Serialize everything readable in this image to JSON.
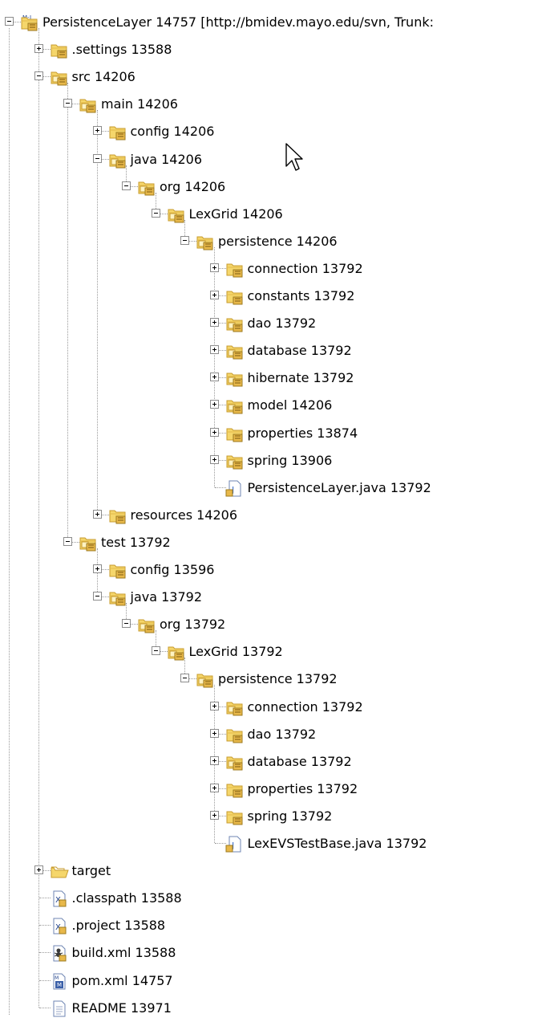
{
  "tree": {
    "nodes": [
      {
        "label": "PersistenceLayer 14757 [http://bmidev.mayo.edu/svn, Trunk:",
        "depth": 0,
        "icon": "maven-project-icon",
        "toggle": "minus",
        "name": "tree-node-persistencelayer-project"
      },
      {
        "label": ".settings 13588",
        "depth": 1,
        "icon": "folder-icon",
        "toggle": "plus",
        "name": "tree-node-settings"
      },
      {
        "label": "src 14206",
        "depth": 1,
        "icon": "source-folder-icon",
        "toggle": "minus",
        "name": "tree-node-src"
      },
      {
        "label": "main 14206",
        "depth": 2,
        "icon": "source-folder-icon",
        "toggle": "minus",
        "name": "tree-node-main"
      },
      {
        "label": "config 14206",
        "depth": 3,
        "icon": "folder-icon",
        "toggle": "plus",
        "name": "tree-node-main-config"
      },
      {
        "label": "java 14206",
        "depth": 3,
        "icon": "source-folder-icon",
        "toggle": "minus",
        "name": "tree-node-main-java"
      },
      {
        "label": "org 14206",
        "depth": 4,
        "icon": "source-folder-icon",
        "toggle": "minus",
        "name": "tree-node-main-org"
      },
      {
        "label": "LexGrid 14206",
        "depth": 5,
        "icon": "source-folder-icon",
        "toggle": "minus",
        "name": "tree-node-main-lexgrid"
      },
      {
        "label": "persistence 14206",
        "depth": 6,
        "icon": "source-folder-icon",
        "toggle": "minus",
        "name": "tree-node-main-persistence"
      },
      {
        "label": "connection 13792",
        "depth": 7,
        "icon": "folder-icon",
        "toggle": "plus",
        "name": "tree-node-main-connection"
      },
      {
        "label": "constants 13792",
        "depth": 7,
        "icon": "folder-icon",
        "toggle": "plus",
        "name": "tree-node-main-constants"
      },
      {
        "label": "dao 13792",
        "depth": 7,
        "icon": "source-folder-icon",
        "toggle": "plus",
        "name": "tree-node-main-dao"
      },
      {
        "label": "database 13792",
        "depth": 7,
        "icon": "source-folder-icon",
        "toggle": "plus",
        "name": "tree-node-main-database"
      },
      {
        "label": "hibernate 13792",
        "depth": 7,
        "icon": "source-folder-icon",
        "toggle": "plus",
        "name": "tree-node-main-hibernate"
      },
      {
        "label": "model 14206",
        "depth": 7,
        "icon": "source-folder-icon",
        "toggle": "plus",
        "name": "tree-node-main-model"
      },
      {
        "label": "properties 13874",
        "depth": 7,
        "icon": "folder-icon",
        "toggle": "plus",
        "name": "tree-node-main-properties"
      },
      {
        "label": "spring 13906",
        "depth": 7,
        "icon": "source-folder-icon",
        "toggle": "plus",
        "name": "tree-node-main-spring"
      },
      {
        "label": "PersistenceLayer.java 13792",
        "depth": 7,
        "icon": "java-file-icon",
        "toggle": "none",
        "name": "tree-node-persistencelayer-java"
      },
      {
        "label": "resources 14206",
        "depth": 3,
        "icon": "folder-icon",
        "toggle": "plus",
        "name": "tree-node-resources"
      },
      {
        "label": "test 13792",
        "depth": 2,
        "icon": "source-folder-icon",
        "toggle": "minus",
        "name": "tree-node-test"
      },
      {
        "label": "config 13596",
        "depth": 3,
        "icon": "folder-icon",
        "toggle": "plus",
        "name": "tree-node-test-config"
      },
      {
        "label": "java 13792",
        "depth": 3,
        "icon": "source-folder-icon",
        "toggle": "minus",
        "name": "tree-node-test-java"
      },
      {
        "label": "org 13792",
        "depth": 4,
        "icon": "source-folder-icon",
        "toggle": "minus",
        "name": "tree-node-test-org"
      },
      {
        "label": "LexGrid 13792",
        "depth": 5,
        "icon": "source-folder-icon",
        "toggle": "minus",
        "name": "tree-node-test-lexgrid"
      },
      {
        "label": "persistence 13792",
        "depth": 6,
        "icon": "source-folder-icon",
        "toggle": "minus",
        "name": "tree-node-test-persistence"
      },
      {
        "label": "connection 13792",
        "depth": 7,
        "icon": "source-folder-icon",
        "toggle": "plus",
        "name": "tree-node-test-connection"
      },
      {
        "label": "dao 13792",
        "depth": 7,
        "icon": "folder-icon",
        "toggle": "plus",
        "name": "tree-node-test-dao"
      },
      {
        "label": "database 13792",
        "depth": 7,
        "icon": "source-folder-icon",
        "toggle": "plus",
        "name": "tree-node-test-database"
      },
      {
        "label": "properties 13792",
        "depth": 7,
        "icon": "folder-icon",
        "toggle": "plus",
        "name": "tree-node-test-properties"
      },
      {
        "label": "spring 13792",
        "depth": 7,
        "icon": "folder-icon",
        "toggle": "plus",
        "name": "tree-node-test-spring"
      },
      {
        "label": "LexEVSTestBase.java 13792",
        "depth": 7,
        "icon": "java-file-icon",
        "toggle": "none",
        "name": "tree-node-lexevstestbase-java"
      },
      {
        "label": "target",
        "depth": 1,
        "icon": "open-folder-icon",
        "toggle": "plus",
        "name": "tree-node-target"
      },
      {
        "label": ".classpath 13588",
        "depth": 1,
        "icon": "xml-file-icon",
        "toggle": "none",
        "name": "tree-node-classpath"
      },
      {
        "label": ".project 13588",
        "depth": 1,
        "icon": "xml-file-icon",
        "toggle": "none",
        "name": "tree-node-project"
      },
      {
        "label": "build.xml 13588",
        "depth": 1,
        "icon": "ant-file-icon",
        "toggle": "none",
        "name": "tree-node-build-xml"
      },
      {
        "label": "pom.xml 14757",
        "depth": 1,
        "icon": "maven-pom-icon",
        "toggle": "none",
        "name": "tree-node-pom-xml"
      },
      {
        "label": "README 13971",
        "depth": 1,
        "icon": "text-file-icon",
        "toggle": "none",
        "name": "tree-node-readme"
      }
    ]
  },
  "colors": {
    "folder_body": "#f5d66b",
    "folder_edge": "#c79b2e",
    "svn_badge": "#e8b84a",
    "tree_line": "#9a9a9a",
    "java_blue": "#3a6cc8"
  }
}
